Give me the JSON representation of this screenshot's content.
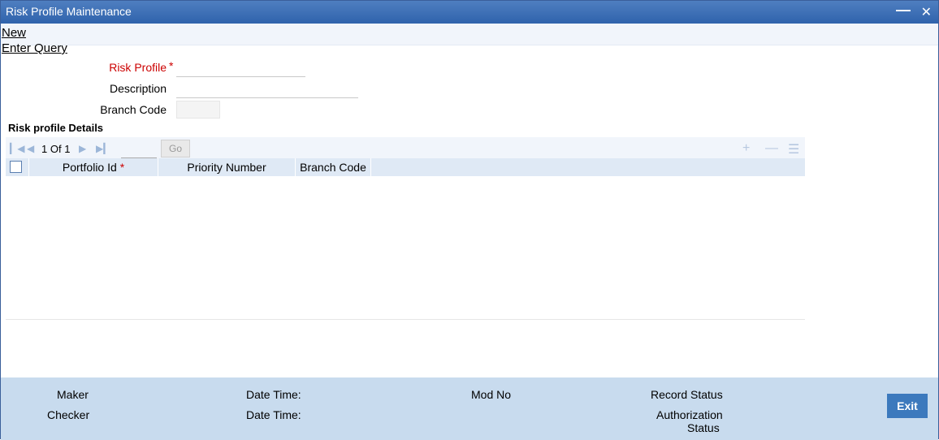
{
  "window": {
    "title": "Risk Profile Maintenance"
  },
  "menu": {
    "new_label": "New",
    "query_label": "Enter Query"
  },
  "form": {
    "risk_profile_label": "Risk Profile",
    "required_marker": "*",
    "description_label": "Description",
    "branch_code_label": "Branch Code",
    "risk_profile_value": "",
    "description_value": "",
    "branch_code_value": ""
  },
  "details": {
    "section_title": "Risk profile Details",
    "pager_current": "1",
    "pager_of": "Of",
    "pager_total": "1",
    "go_label": "Go",
    "columns": [
      {
        "label": "Portfolio Id",
        "required": true
      },
      {
        "label": "Priority Number",
        "required": false
      },
      {
        "label": "Branch Code",
        "required": false
      }
    ],
    "rows": []
  },
  "footer": {
    "maker_label": "Maker",
    "checker_label": "Checker",
    "date_time_label": "Date Time:",
    "mod_no_label": "Mod No",
    "record_status_label": "Record Status",
    "authorization_label": "Authorization",
    "status_label": "Status",
    "exit_label": "Exit"
  },
  "icons": {
    "first": "first-page-icon",
    "prev": "prev-page-icon",
    "next": "next-page-icon",
    "last": "last-page-icon",
    "add": "add-row-icon",
    "remove": "remove-row-icon",
    "list": "list-view-icon",
    "minimize": "minimize-icon",
    "close": "close-icon"
  },
  "colors": {
    "titlebar": "#2f63ac",
    "footer": "#c8dbee",
    "exit_button": "#3c79bd",
    "required": "#cc0000"
  }
}
